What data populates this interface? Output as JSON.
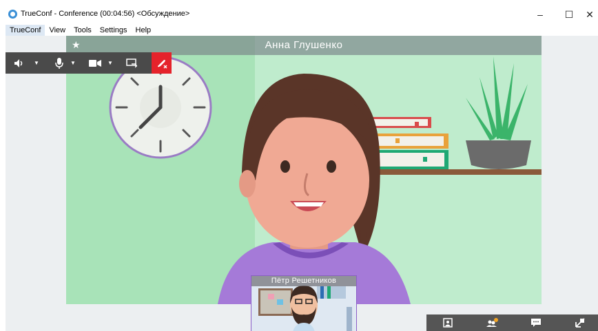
{
  "window": {
    "title": "TrueConf - Conference (00:04:56) <Обсуждение>",
    "minimize": "–",
    "maximize": "☐",
    "close": "✕"
  },
  "menu": [
    "TrueConf",
    "View",
    "Tools",
    "Settings",
    "Help"
  ],
  "main_video": {
    "participant_name": "Анна Глушенко",
    "star": "★"
  },
  "pip_video": {
    "participant_name": "Пётр Решетников"
  },
  "toolbar": {
    "items": [
      "speaker-icon",
      "microphone-icon",
      "camera-icon",
      "share-screen-icon",
      "hangup-icon"
    ],
    "arrow": "▼"
  },
  "bottom_toolbar": {
    "items": [
      "contacts-icon",
      "participants-icon",
      "chat-icon",
      "expand-icon"
    ],
    "notification_color": "#f5a623"
  },
  "colors": {
    "video_bg": "#bfeccd",
    "hangup": "#e5232b",
    "toolbar": "#4a4a4a"
  }
}
